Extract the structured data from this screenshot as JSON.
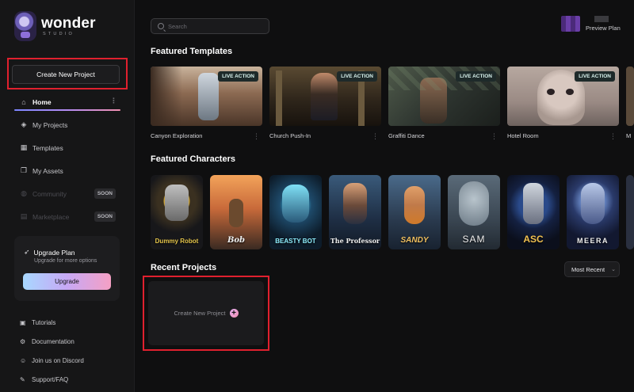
{
  "app": {
    "logo_word": "wonder",
    "logo_sub": "STUDIO"
  },
  "sidebar": {
    "create_label": "Create New Project",
    "items": [
      {
        "label": "Home",
        "icon": "home-icon",
        "active": true
      },
      {
        "label": "My Projects",
        "icon": "cube-icon"
      },
      {
        "label": "Templates",
        "icon": "layout-icon"
      },
      {
        "label": "My Assets",
        "icon": "assets-icon"
      },
      {
        "label": "Community",
        "icon": "globe-icon",
        "badge": "SOON"
      },
      {
        "label": "Marketplace",
        "icon": "store-icon",
        "badge": "SOON"
      }
    ],
    "upgrade": {
      "title": "Upgrade Plan",
      "subtitle": "Upgrade for more options",
      "button": "Upgrade"
    },
    "footer": [
      {
        "label": "Tutorials",
        "icon": "tutorial-icon"
      },
      {
        "label": "Documentation",
        "icon": "doc-icon"
      },
      {
        "label": "Join us on Discord",
        "icon": "discord-icon"
      },
      {
        "label": "Support/FAQ",
        "icon": "support-icon"
      }
    ]
  },
  "header": {
    "search_placeholder": "Search",
    "plan_label": "Preview Plan"
  },
  "featured_templates": {
    "title": "Featured Templates",
    "badge": "LIVE ACTION",
    "items": [
      {
        "name": "Canyon Exploration"
      },
      {
        "name": "Church Push-In"
      },
      {
        "name": "Graffiti Dance"
      },
      {
        "name": "Hotel Room"
      },
      {
        "name": "M"
      }
    ]
  },
  "featured_characters": {
    "title": "Featured Characters",
    "items": [
      {
        "name": "Dummy Robot"
      },
      {
        "name": "Bob"
      },
      {
        "name": "BEASTY BOT"
      },
      {
        "name": "The Professor"
      },
      {
        "name": "SANDY"
      },
      {
        "name": "SAM"
      },
      {
        "name": "ASC"
      },
      {
        "name": "MEERA"
      }
    ]
  },
  "recent_projects": {
    "title": "Recent Projects",
    "sort_label": "Most Recent",
    "create_label": "Create New Project"
  }
}
